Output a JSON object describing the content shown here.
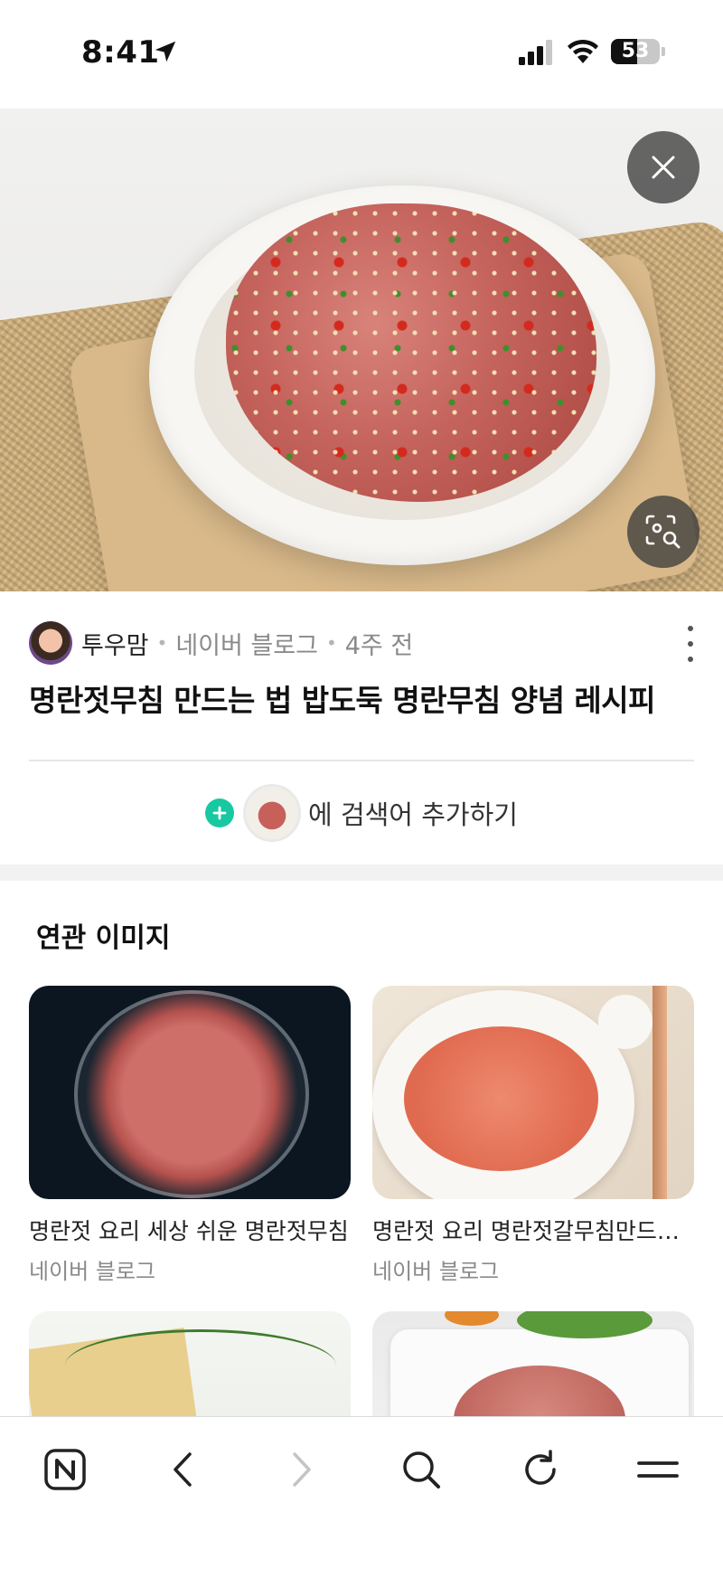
{
  "status_bar": {
    "time": "8:41",
    "battery": "53",
    "battery_level": 0.53,
    "icons": [
      "location-arrow-icon",
      "signal-icon",
      "wifi-icon",
      "battery-icon"
    ]
  },
  "hero": {
    "close_icon": "close-icon",
    "lens_icon": "image-search-icon"
  },
  "post": {
    "author": "투우맘",
    "separator": "•",
    "site": "네이버 블로그",
    "time": "4주 전",
    "title": "명란젓무침 만드는 법 밥도둑 명란무침 양념 레시피",
    "more_icon": "more-vertical-icon"
  },
  "add_search": {
    "plus": "+",
    "label": "에 검색어 추가하기"
  },
  "related": {
    "heading": "연관 이미지",
    "items": [
      {
        "title": "명란젓 요리 세상 쉬운 명란젓무침",
        "source": "네이버 블로그"
      },
      {
        "title": "명란젓 요리 명란젓갈무침만드는 법",
        "source": "네이버 블로그"
      }
    ]
  },
  "bottom_bar": {
    "items": [
      "naver-home-icon",
      "back-icon",
      "forward-icon",
      "search-icon",
      "refresh-icon",
      "menu-icon"
    ]
  },
  "colors": {
    "accent": "#18c8a0",
    "text_primary": "#111111",
    "text_secondary": "#8a8a8a"
  }
}
